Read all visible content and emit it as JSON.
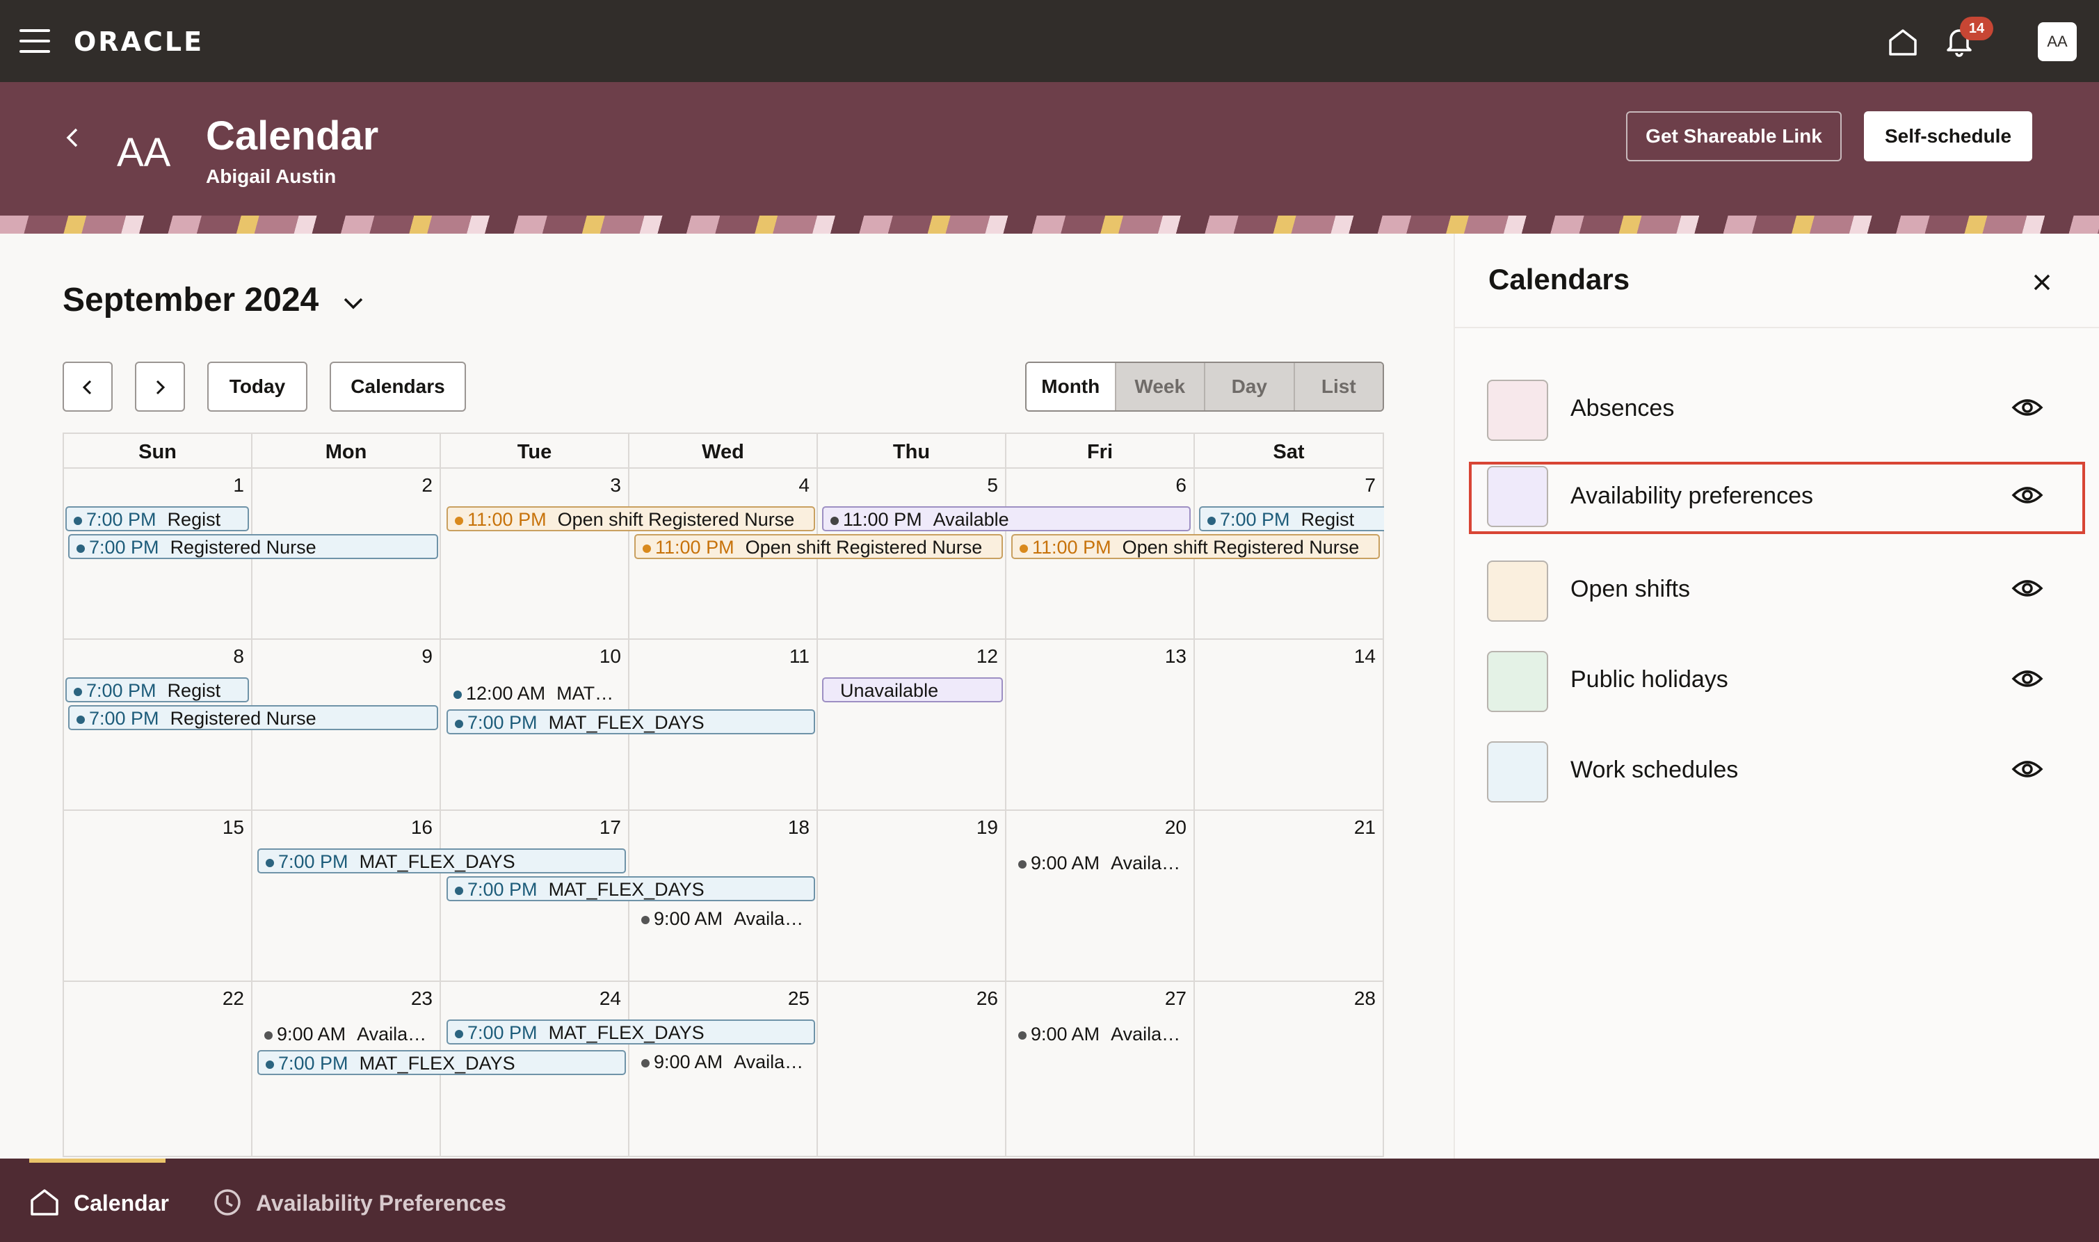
{
  "topbar": {
    "brand": "ORACLE",
    "notification_count": "14",
    "user_initials": "AA"
  },
  "header": {
    "initials": "AA",
    "title": "Calendar",
    "subtitle": "Abigail Austin",
    "share_button": "Get Shareable Link",
    "self_schedule_button": "Self-schedule"
  },
  "calendar": {
    "month_label": "September 2024",
    "today_button": "Today",
    "calendars_button": "Calendars",
    "views": [
      "Month",
      "Week",
      "Day",
      "List"
    ],
    "active_view": "Month",
    "weekdays": [
      "Sun",
      "Mon",
      "Tue",
      "Wed",
      "Thu",
      "Fri",
      "Sat"
    ],
    "days": [
      "1",
      "2",
      "3",
      "4",
      "5",
      "6",
      "7",
      "8",
      "9",
      "10",
      "11",
      "12",
      "13",
      "14",
      "15",
      "16",
      "17",
      "18",
      "19",
      "20",
      "21",
      "22",
      "23",
      "24",
      "25",
      "26",
      "27",
      "28"
    ]
  },
  "events": {
    "e1": {
      "time": "7:00 PM",
      "title": "Regist"
    },
    "e2": {
      "time": "7:00 PM",
      "title": "Registered Nurse"
    },
    "e3": {
      "time": "11:00 PM",
      "title": "Open shift Registered Nurse"
    },
    "e4": {
      "time": "11:00 PM",
      "title": "Available"
    },
    "e5": {
      "time": "11:00 PM",
      "title": "Open shift Registered Nurse"
    },
    "e6": {
      "time": "11:00 PM",
      "title": "Open shift Registered Nurse"
    },
    "e7": {
      "time": "7:00 PM",
      "title": "Regist"
    },
    "e8": {
      "time": "7:00 PM",
      "title": "Regist"
    },
    "e9": {
      "time": "7:00 PM",
      "title": "Registered Nurse"
    },
    "e10": {
      "time": "12:00 AM",
      "title": "MAT…"
    },
    "e11": {
      "time": "7:00 PM",
      "title": "MAT_FLEX_DAYS"
    },
    "e12": {
      "title": "Unavailable"
    },
    "e13": {
      "time": "7:00 PM",
      "title": "MAT_FLEX_DAYS"
    },
    "e14": {
      "time": "7:00 PM",
      "title": "MAT_FLEX_DAYS"
    },
    "e15": {
      "time": "9:00 AM",
      "title": "Availa…"
    },
    "e16": {
      "time": "9:00 AM",
      "title": "Availa…"
    },
    "e17": {
      "time": "9:00 AM",
      "title": "Availa…"
    },
    "e18": {
      "time": "7:00 PM",
      "title": "MAT_FLEX_DAYS"
    },
    "e19": {
      "time": "7:00 PM",
      "title": "MAT_FLEX_DAYS"
    },
    "e20": {
      "time": "9:00 AM",
      "title": "Availa…"
    },
    "e21": {
      "time": "9:00 AM",
      "title": "Availa…"
    }
  },
  "panel": {
    "title": "Calendars",
    "items": [
      {
        "label": "Absences",
        "color": "#f7e8eb"
      },
      {
        "label": "Availability preferences",
        "color": "#efeafa"
      },
      {
        "label": "Open shifts",
        "color": "#faefde"
      },
      {
        "label": "Public holidays",
        "color": "#e4f2e6"
      },
      {
        "label": "Work schedules",
        "color": "#eaf3f8"
      }
    ]
  },
  "bottom_nav": {
    "calendar": "Calendar",
    "availability": "Availability Preferences"
  }
}
